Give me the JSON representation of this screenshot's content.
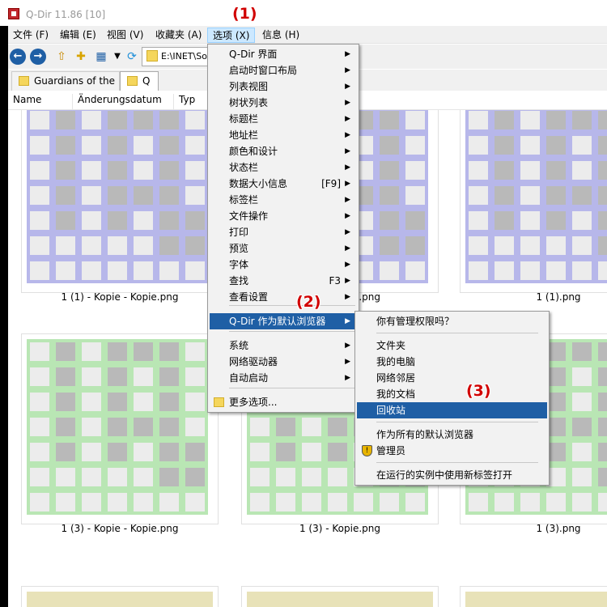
{
  "window": {
    "title": "Q-Dir 11.86 [10]"
  },
  "menubar": {
    "items": [
      "文件 (F)",
      "编辑 (E)",
      "视图 (V)",
      "收藏夹 (A)",
      "选项 (X)",
      "信息 (H)"
    ]
  },
  "toolbar": {
    "address": "E:\\INET\\Sof"
  },
  "tabs": [
    "Guardians of the ...",
    "Q"
  ],
  "columns": [
    "Name",
    "Änderungsdatum",
    "Typ"
  ],
  "files": [
    {
      "name": "1 (1) - Kopie - Kopie.png",
      "color": "#b7b7ea"
    },
    {
      "name": "1 (1) - Kopie.png",
      "color": "#b7b7ea"
    },
    {
      "name": "1 (1).png",
      "color": "#b7b7ea"
    },
    {
      "name": "1 (3) - Kopie - Kopie.png",
      "color": "#b9e6b4"
    },
    {
      "name": "1 (3) - Kopie.png",
      "color": "#b9e6b4"
    },
    {
      "name": "1 (3).png",
      "color": "#b9e6b4"
    }
  ],
  "options_menu": {
    "items": [
      {
        "label": "Q-Dir 界面",
        "arrow": "▶"
      },
      {
        "label": "启动时窗口布局",
        "arrow": "▶"
      },
      {
        "label": "列表视图",
        "arrow": "▶"
      },
      {
        "label": "树状列表",
        "arrow": "▶"
      },
      {
        "label": "标题栏",
        "arrow": "▶"
      },
      {
        "label": "地址栏",
        "arrow": "▶"
      },
      {
        "label": "颜色和设计",
        "arrow": "▶"
      },
      {
        "label": "状态栏",
        "arrow": "▶"
      },
      {
        "label": "数据大小信息",
        "shortcut": "[F9]",
        "arrow": "▶"
      },
      {
        "label": "标签栏",
        "arrow": "▶"
      },
      {
        "label": "文件操作",
        "arrow": "▶"
      },
      {
        "label": "打印",
        "arrow": "▶"
      },
      {
        "label": "预览",
        "arrow": "▶"
      },
      {
        "label": "字体",
        "arrow": "▶"
      },
      {
        "label": "查找",
        "shortcut": "F3",
        "arrow": "▶"
      },
      {
        "label": "查看设置",
        "arrow": "▶"
      },
      {
        "label": "Q-Dir 作为默认浏览器",
        "arrow": "▶"
      },
      {
        "label": "系统",
        "arrow": "▶"
      },
      {
        "label": "网络驱动器",
        "arrow": "▶"
      },
      {
        "label": "自动启动",
        "arrow": "▶"
      },
      {
        "label": "更多选项..."
      }
    ]
  },
  "submenu": {
    "items": [
      "你有管理权限吗？",
      "文件夹",
      "我的电脑",
      "网络邻居",
      "我的文档",
      "回收站",
      "作为所有的默认浏览器",
      "管理员",
      "在运行的实例中使用新标签打开"
    ]
  },
  "badges": [
    "(1)",
    "(2)",
    "(3)"
  ],
  "icons": {
    "back": "arrow-left-icon",
    "forward": "arrow-right-icon"
  }
}
